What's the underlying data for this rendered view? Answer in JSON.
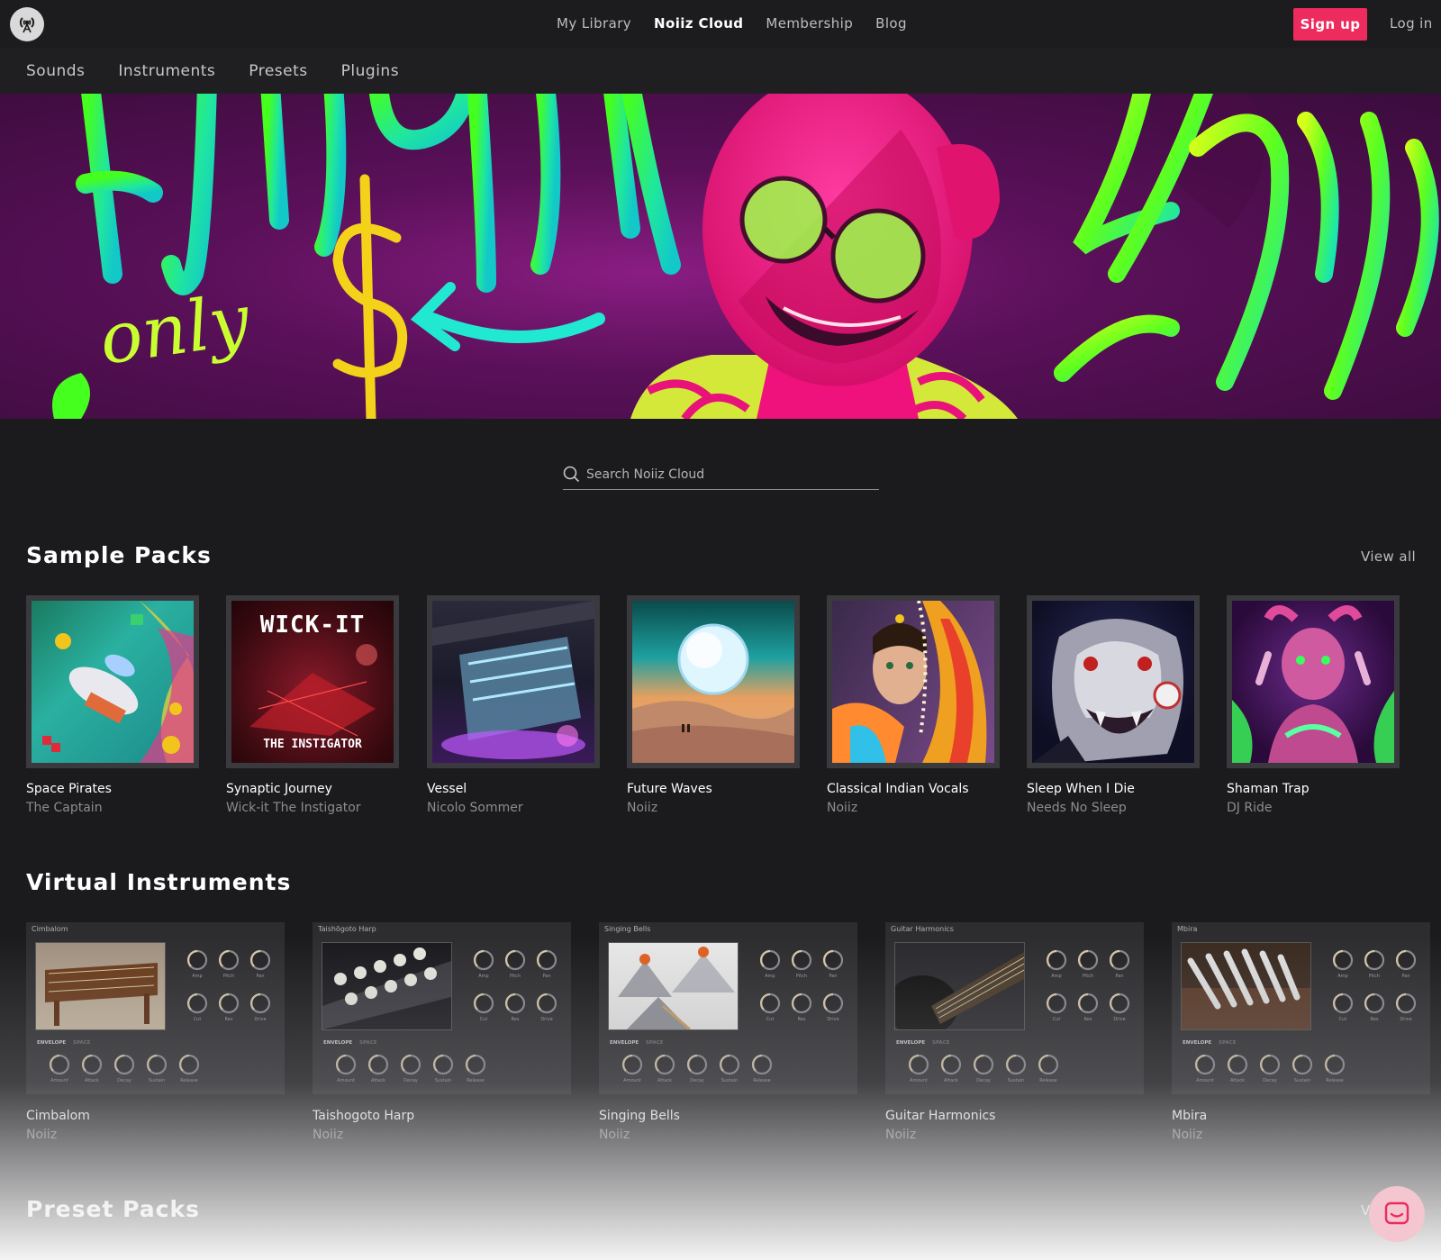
{
  "topbar": {
    "nav": [
      {
        "label": "My Library",
        "active": false
      },
      {
        "label": "Noiiz Cloud",
        "active": true
      },
      {
        "label": "Membership",
        "active": false
      },
      {
        "label": "Blog",
        "active": false
      }
    ],
    "signup_label": "Sign up",
    "login_label": "Log in",
    "accent_color": "#ee2b5e"
  },
  "subnav": {
    "items": [
      "Sounds",
      "Instruments",
      "Presets",
      "Plugins"
    ]
  },
  "hero": {
    "text_only": "only",
    "colors": {
      "background": "#5a1059",
      "lettering": "#39f02a",
      "figure": "#f4157d"
    }
  },
  "search": {
    "placeholder": "Search Noiiz Cloud"
  },
  "sample_packs": {
    "title": "Sample Packs",
    "view_all": "View all",
    "items": [
      {
        "name": "Space Pirates",
        "author": "The Captain"
      },
      {
        "name": "Synaptic Journey",
        "author": "Wick-it The Instigator",
        "cover_top": "WICK-IT",
        "cover_bottom": "THE INSTIGATOR"
      },
      {
        "name": "Vessel",
        "author": "Nicolo Sommer"
      },
      {
        "name": "Future Waves",
        "author": "Noiiz"
      },
      {
        "name": "Classical Indian Vocals",
        "author": "Noiiz"
      },
      {
        "name": "Sleep When I Die",
        "author": "Needs No Sleep"
      },
      {
        "name": "Shaman Trap",
        "author": "DJ Ride"
      }
    ]
  },
  "virtual_instruments": {
    "title": "Virtual Instruments",
    "items": [
      {
        "name": "Cimbalom",
        "author": "Noiiz",
        "panel_title": "Cimbalom"
      },
      {
        "name": "Taishogoto Harp",
        "author": "Noiiz",
        "panel_title": "Taishōgoto Harp"
      },
      {
        "name": "Singing Bells",
        "author": "Noiiz",
        "panel_title": "Singing Bells"
      },
      {
        "name": "Guitar Harmonics",
        "author": "Noiiz",
        "panel_title": "Guitar Harmonics"
      },
      {
        "name": "Mbira",
        "author": "Noiiz",
        "panel_title": "Mbira"
      }
    ],
    "knob_labels_top": [
      "Amp",
      "Pitch",
      "Pan"
    ],
    "knob_labels_mid": [
      "Cut",
      "Res",
      "Drive"
    ],
    "knob_labels_bottom": [
      "Amount",
      "Attack",
      "Decay",
      "Sustain",
      "Release"
    ],
    "tab_envelope": "ENVELOPE",
    "tab_space": "SPACE"
  },
  "preset_packs": {
    "title": "Preset Packs",
    "view_all": "V"
  }
}
